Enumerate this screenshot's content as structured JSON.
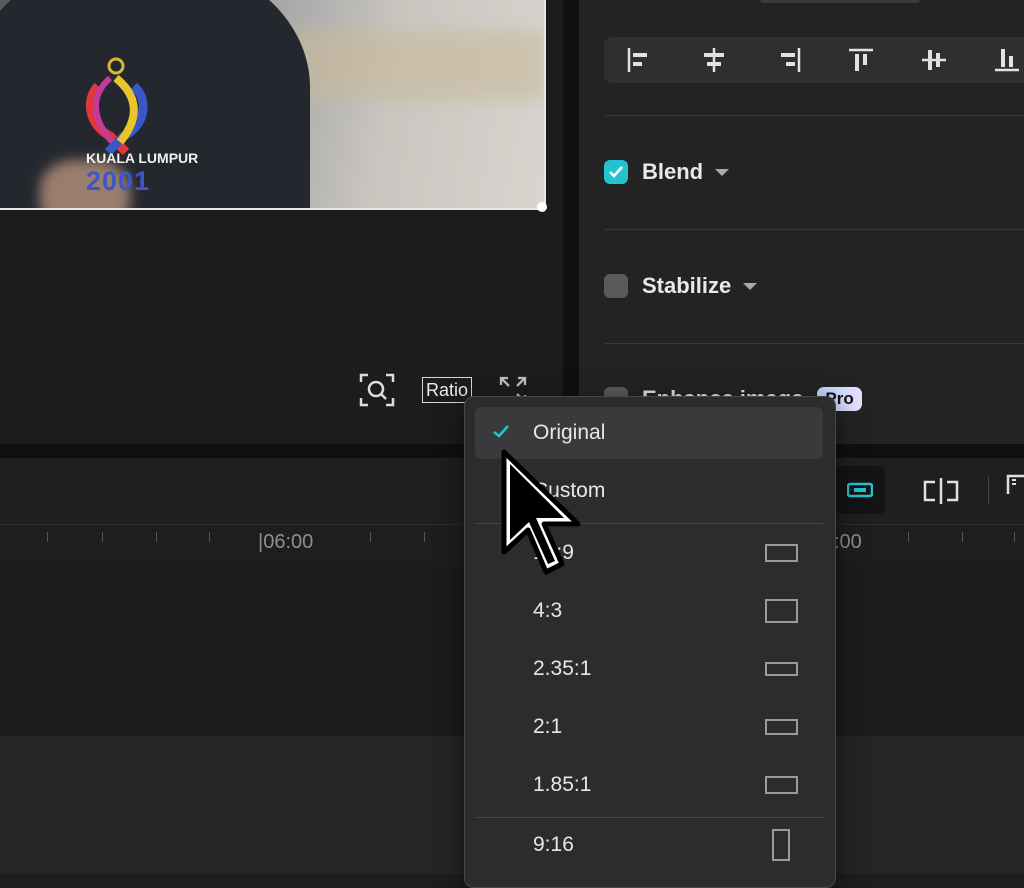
{
  "preview": {
    "emblem_line1": "KUALA LUMPUR",
    "emblem_line2": "2001",
    "tools": {
      "ratio_label": "Ratio"
    }
  },
  "properties": {
    "blend": {
      "label": "Blend",
      "checked": true
    },
    "stabilize": {
      "label": "Stabilize",
      "checked": false
    },
    "enhance": {
      "label": "Enhance image",
      "badge": "Pro"
    }
  },
  "timeline": {
    "ruler_labels": [
      "|06:00",
      ":00"
    ]
  },
  "ratio_menu": {
    "items": [
      {
        "label": "Original",
        "selected": true
      },
      {
        "label": "Custom",
        "selected": false
      },
      {
        "label": "16:9",
        "selected": false
      },
      {
        "label": "4:3",
        "selected": false
      },
      {
        "label": "2.35:1",
        "selected": false
      },
      {
        "label": "2:1",
        "selected": false
      },
      {
        "label": "1.85:1",
        "selected": false
      },
      {
        "label": "9:16",
        "selected": false
      }
    ]
  },
  "colors": {
    "accent": "#22c3cf",
    "panel": "#232324",
    "menu_bg": "#2c2c2e"
  },
  "icons": [
    "zoom-fit-icon",
    "fullscreen-icon",
    "align-left-icon",
    "align-center-h-icon",
    "align-right-icon",
    "align-top-icon",
    "align-middle-v-icon",
    "align-bottom-icon",
    "checkmark-icon",
    "link-icon",
    "split-icon"
  ]
}
